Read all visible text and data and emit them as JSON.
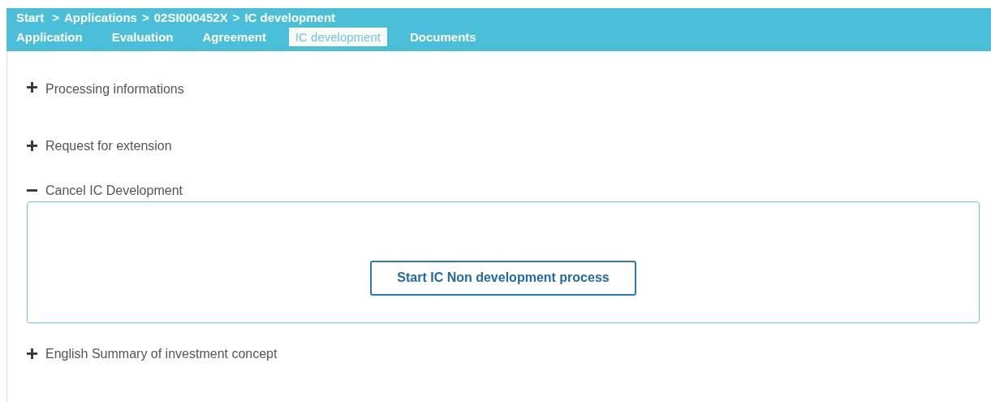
{
  "breadcrumb": [
    {
      "kind": "link",
      "text": "Start"
    },
    {
      "kind": "separator",
      "text": ">"
    },
    {
      "kind": "link",
      "text": "Applications"
    },
    {
      "kind": "separator",
      "text": ">"
    },
    {
      "kind": "link",
      "text": "02SI000452X"
    },
    {
      "kind": "separator",
      "text": ">"
    },
    {
      "kind": "current",
      "text": "IC development"
    }
  ],
  "tabs": [
    {
      "label": "Application",
      "selected": false
    },
    {
      "label": "Evaluation",
      "selected": false
    },
    {
      "label": "Agreement",
      "selected": false
    },
    {
      "label": "IC development",
      "selected": true
    },
    {
      "label": "Documents",
      "selected": false
    }
  ],
  "sections": [
    {
      "title": "Processing informations",
      "expanded": false
    },
    {
      "title": "Request for extension",
      "expanded": false
    },
    {
      "title": "Cancel IC Development",
      "expanded": true,
      "button": "Start IC Non development process"
    },
    {
      "title": "English Summary of investment concept",
      "expanded": false
    }
  ]
}
